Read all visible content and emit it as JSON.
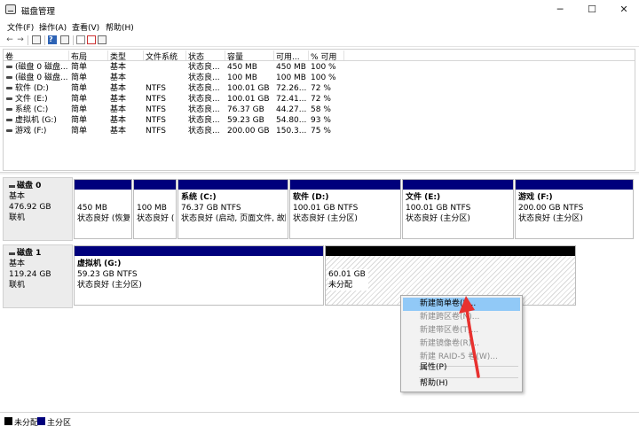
{
  "window": {
    "title": "磁盘管理",
    "controls": {
      "minimize": "─",
      "maximize": "☐",
      "close": "✕"
    }
  },
  "menubar": [
    "文件(F)",
    "操作(A)",
    "查看(V)",
    "帮助(H)"
  ],
  "toolbar": {
    "back": "←",
    "forward": "→",
    "help": "?"
  },
  "volume_table": {
    "columns": [
      "卷",
      "布局",
      "类型",
      "文件系统",
      "状态",
      "容量",
      "可用...",
      "% 可用"
    ],
    "rows": [
      [
        "(磁盘 0 磁盘...",
        "简单",
        "基本",
        "",
        "状态良...",
        "450 MB",
        "450 MB",
        "100 %"
      ],
      [
        "(磁盘 0 磁盘...",
        "简单",
        "基本",
        "",
        "状态良...",
        "100 MB",
        "100 MB",
        "100 %"
      ],
      [
        "软件 (D:)",
        "简单",
        "基本",
        "NTFS",
        "状态良...",
        "100.01 GB",
        "72.26...",
        "72 %"
      ],
      [
        "文件 (E:)",
        "简单",
        "基本",
        "NTFS",
        "状态良...",
        "100.01 GB",
        "72.41...",
        "72 %"
      ],
      [
        "系统 (C:)",
        "简单",
        "基本",
        "NTFS",
        "状态良...",
        "76.37 GB",
        "44.27...",
        "58 %"
      ],
      [
        "虚拟机 (G:)",
        "简单",
        "基本",
        "NTFS",
        "状态良...",
        "59.23 GB",
        "54.80...",
        "93 %"
      ],
      [
        "游戏 (F:)",
        "简单",
        "基本",
        "NTFS",
        "状态良...",
        "200.00 GB",
        "150.3...",
        "75 %"
      ]
    ]
  },
  "disks": [
    {
      "name": "磁盘 0",
      "type": "基本",
      "size": "476.92 GB",
      "status": "联机",
      "partitions": [
        {
          "name": "",
          "size": "450 MB",
          "status": "状态良好 (恢复分",
          "unallocated": false
        },
        {
          "name": "",
          "size": "100 MB",
          "status": "状态良好 (EFI",
          "unallocated": false
        },
        {
          "name": "系统  (C:)",
          "size": "76.37 GB NTFS",
          "status": "状态良好 (启动, 页面文件, 故障",
          "unallocated": false
        },
        {
          "name": "软件  (D:)",
          "size": "100.01 GB NTFS",
          "status": "状态良好 (主分区)",
          "unallocated": false
        },
        {
          "name": "文件  (E:)",
          "size": "100.01 GB NTFS",
          "status": "状态良好 (主分区)",
          "unallocated": false
        },
        {
          "name": "游戏  (F:)",
          "size": "200.00 GB NTFS",
          "status": "状态良好 (主分区)",
          "unallocated": false
        }
      ]
    },
    {
      "name": "磁盘 1",
      "type": "基本",
      "size": "119.24 GB",
      "status": "联机",
      "partitions": [
        {
          "name": "虚拟机  (G:)",
          "size": "59.23 GB NTFS",
          "status": "状态良好 (主分区)",
          "unallocated": false
        },
        {
          "name": "",
          "size": "60.01 GB",
          "status": "未分配",
          "unallocated": true
        }
      ]
    }
  ],
  "context_menu": {
    "items": [
      {
        "label": "新建简单卷(I)...",
        "enabled": true,
        "active": true
      },
      {
        "label": "新建跨区卷(N)...",
        "enabled": false,
        "active": false
      },
      {
        "label": "新建带区卷(T)...",
        "enabled": false,
        "active": false
      },
      {
        "label": "新建镜像卷(R)...",
        "enabled": false,
        "active": false
      },
      {
        "label": "新建 RAID-5 卷(W)...",
        "enabled": false,
        "active": false
      },
      {
        "label": "属性(P)",
        "enabled": true,
        "active": false
      },
      {
        "label": "帮助(H)",
        "enabled": true,
        "active": false
      }
    ]
  },
  "legend": [
    {
      "label": "未分配",
      "color": "#000000"
    },
    {
      "label": "主分区",
      "color": "#00007c"
    }
  ],
  "colors": {
    "primary_partition": "#00007c",
    "unallocated": "#000000",
    "menu_highlight": "#91c9f7",
    "annotation_arrow": "#e8312f"
  }
}
